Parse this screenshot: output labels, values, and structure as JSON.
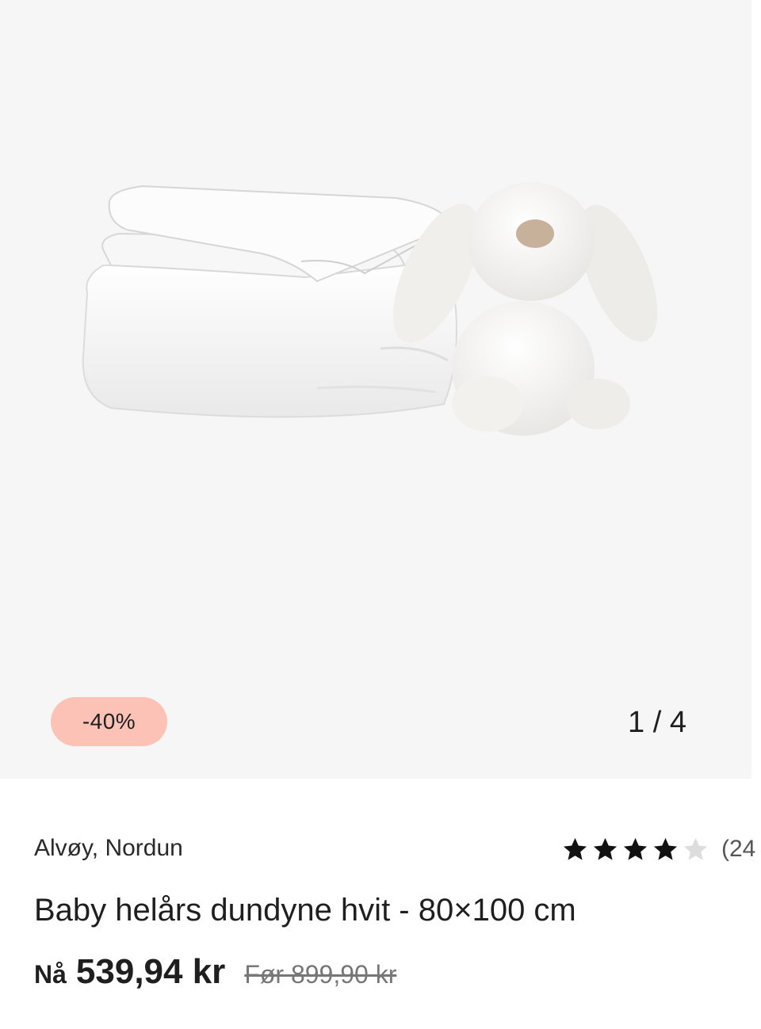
{
  "gallery": {
    "image_icon": "duvet-and-bunny-image",
    "discount": "-40%",
    "counter": "1 / 4"
  },
  "product": {
    "brand": "Alvøy, Nordun",
    "title": "Baby helårs dundyne hvit - 80×100 cm",
    "rating": {
      "stars_filled": 4,
      "stars_total": 5,
      "count_text": "(24"
    },
    "price": {
      "now_label": "Nå",
      "now_value": "539,94 kr",
      "old_value": "Før 899,90 kr"
    }
  },
  "colors": {
    "gallery_bg": "#f6f6f6",
    "badge_bg": "#fbc2b5",
    "star_filled": "#111111",
    "star_empty": "#dddddd"
  }
}
